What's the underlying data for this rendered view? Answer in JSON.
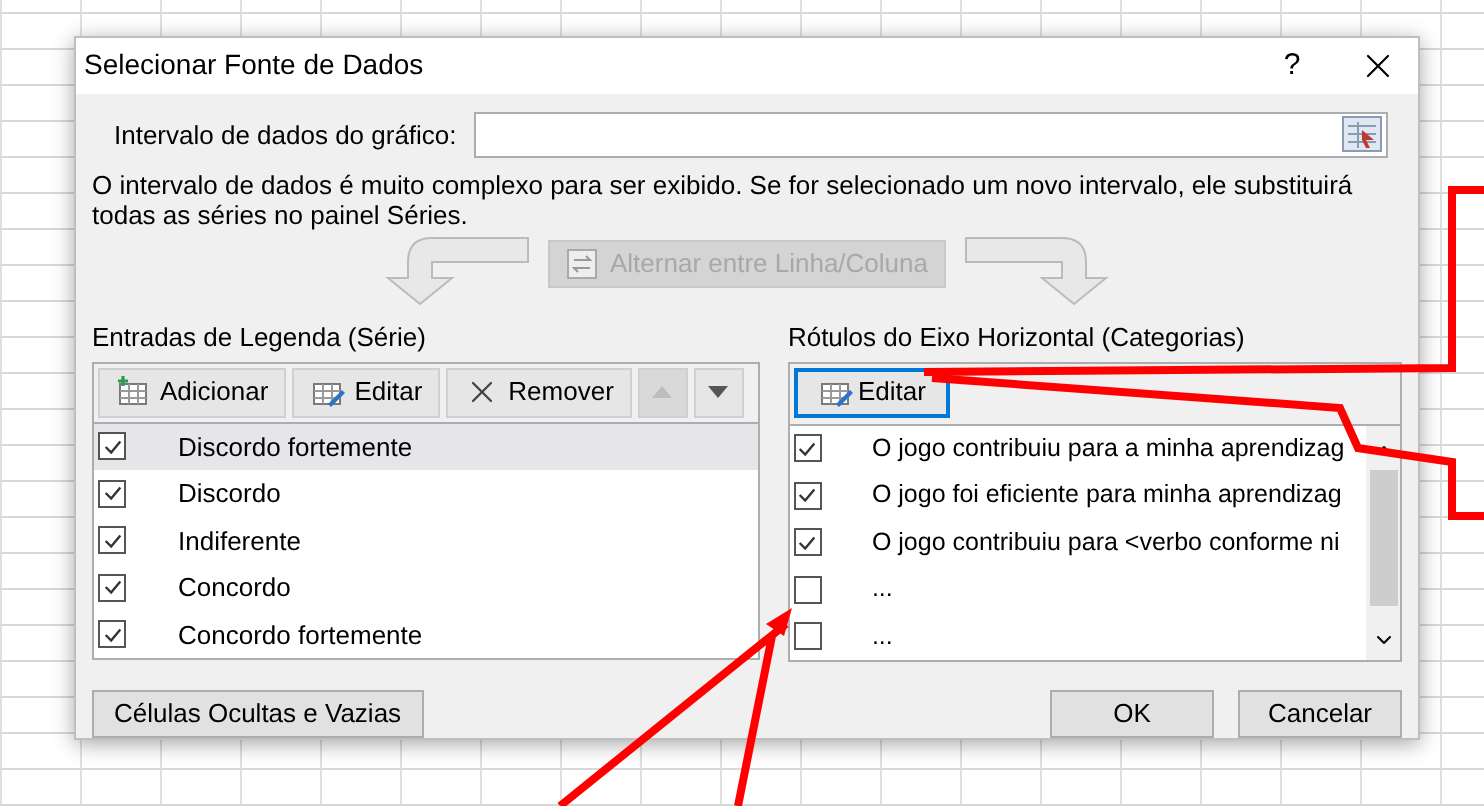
{
  "dialog": {
    "title": "Selecionar Fonte de Dados",
    "help": "?",
    "range_label": "Intervalo de dados do gráfico:",
    "message": "O intervalo de dados é muito complexo para ser exibido. Se for selecionado um novo intervalo, ele substituirá todas as séries no painel Séries.",
    "switch_button": {
      "label": "Alternar entre Linha/Coluna",
      "disabled": true
    },
    "legend": {
      "title": "Entradas de Legenda (Série)",
      "buttons": [
        {
          "label": "Adicionar",
          "kind": "add"
        },
        {
          "label": "Editar",
          "kind": "edit"
        },
        {
          "label": "Remover",
          "kind": "remove"
        }
      ],
      "move_buttons": [
        {
          "kind": "up",
          "disabled": true
        },
        {
          "kind": "down",
          "disabled": false
        }
      ],
      "series": [
        {
          "name": "Discordo fortemente",
          "checked": true,
          "selected": true
        },
        {
          "name": "Discordo",
          "checked": true,
          "selected": false
        },
        {
          "name": "Indiferente",
          "checked": true,
          "selected": false
        },
        {
          "name": "Concordo",
          "checked": true,
          "selected": false
        },
        {
          "name": "Concordo fortemente",
          "checked": true,
          "selected": false
        }
      ]
    },
    "axis": {
      "title": "Rótulos do Eixo Horizontal (Categorias)",
      "edit_button": {
        "label": "Editar",
        "focused": true
      },
      "categories": [
        {
          "label": "O jogo contribuiu para a minha aprendizag",
          "checked": true
        },
        {
          "label": "O jogo foi eficiente para minha aprendizag",
          "checked": true
        },
        {
          "label": "O jogo contribuiu para <verbo conforme ni",
          "checked": true
        },
        {
          "label": "...",
          "checked": false
        },
        {
          "label": "...",
          "checked": false
        }
      ]
    },
    "hidden_cells_button": "Células Ocultas e Vazias",
    "ok_button": "OK",
    "cancel_button": "Cancelar"
  }
}
